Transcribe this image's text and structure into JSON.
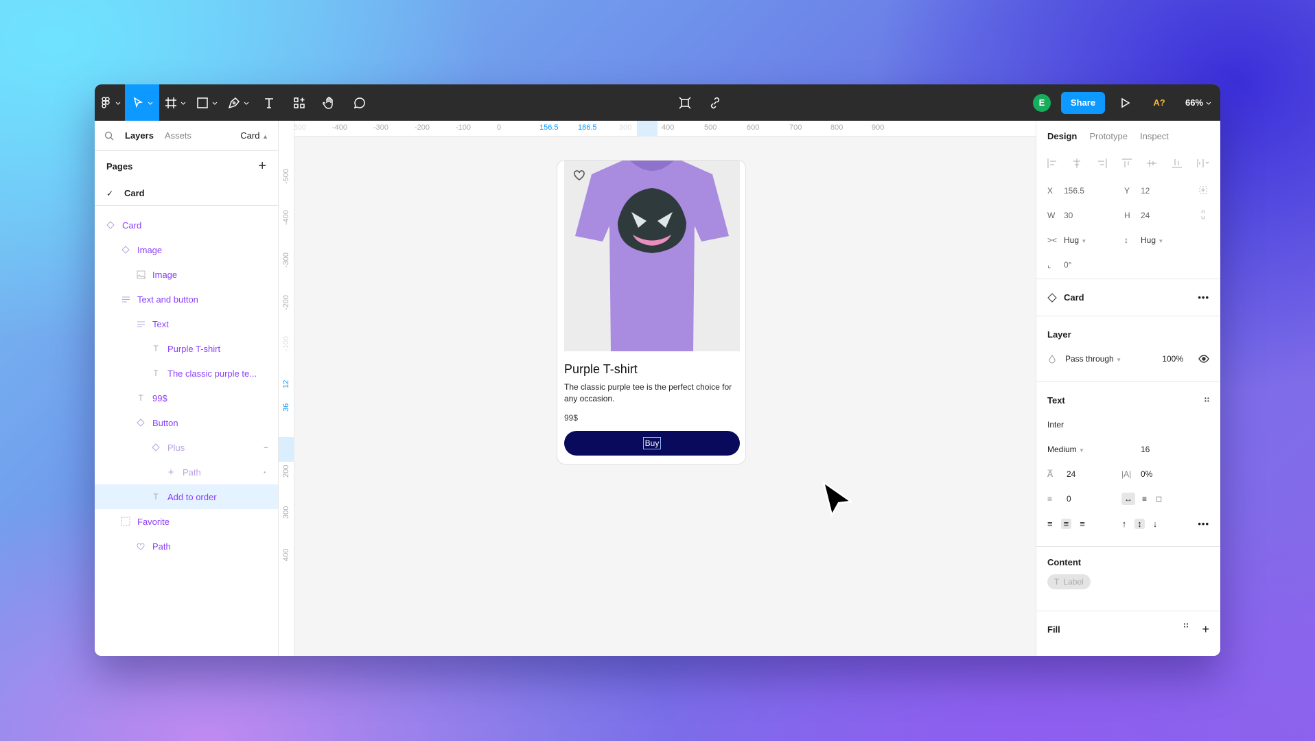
{
  "toolbar": {
    "avatar_initial": "E",
    "share_label": "Share",
    "ai_label": "A?",
    "zoom": "66%"
  },
  "left_panel": {
    "tabs": {
      "layers": "Layers",
      "assets": "Assets",
      "page_select": "Card"
    },
    "pages_title": "Pages",
    "pages": [
      {
        "name": "Card",
        "active": true
      }
    ],
    "layers": [
      {
        "name": "Card",
        "icon": "component-icon",
        "indent": 0
      },
      {
        "name": "Image",
        "icon": "component-icon",
        "indent": 1
      },
      {
        "name": "Image",
        "icon": "image-icon",
        "indent": 2
      },
      {
        "name": "Text and button",
        "icon": "auto-layout-icon",
        "indent": 1
      },
      {
        "name": "Text",
        "icon": "auto-layout-icon",
        "indent": 2
      },
      {
        "name": "Purple T-shirt",
        "icon": "text-icon",
        "indent": 3
      },
      {
        "name": "The classic purple te...",
        "icon": "text-icon",
        "indent": 3
      },
      {
        "name": "99$",
        "icon": "text-icon",
        "indent": 2
      },
      {
        "name": "Button",
        "icon": "component-icon",
        "indent": 2
      },
      {
        "name": "Plus",
        "icon": "component-icon",
        "indent": 3,
        "dim": true
      },
      {
        "name": "Path",
        "icon": "plus-icon",
        "indent": 4,
        "dim": true
      },
      {
        "name": "Add to order",
        "icon": "text-icon",
        "indent": 3,
        "selected": true
      },
      {
        "name": "Favorite",
        "icon": "frame-icon",
        "indent": 1
      },
      {
        "name": "Path",
        "icon": "heart-icon",
        "indent": 2
      }
    ]
  },
  "ruler": {
    "h_ticks": [
      "-500",
      "-400",
      "-300",
      "-200",
      "-100",
      "0",
      "156.5",
      "186.5",
      "300",
      "400",
      "500",
      "600",
      "700",
      "800",
      "900"
    ],
    "v_ticks": [
      "-500",
      "-400",
      "-300",
      "-200",
      "-100",
      "12",
      "36",
      "200",
      "300",
      "400"
    ]
  },
  "card": {
    "title": "Purple T-shirt",
    "description": "The classic purple tee is the perfect choice for any occasion.",
    "price": "99$",
    "button_label": "Buy"
  },
  "right_panel": {
    "tabs": {
      "design": "Design",
      "prototype": "Prototype",
      "inspect": "Inspect"
    },
    "position": {
      "x_label": "X",
      "x": "156.5",
      "y_label": "Y",
      "y": "12",
      "w_label": "W",
      "w": "30",
      "h_label": "H",
      "h": "24",
      "hug_w": "Hug",
      "hug_h": "Hug",
      "rotation": "0°"
    },
    "component": {
      "name": "Card"
    },
    "layer": {
      "title": "Layer",
      "blend": "Pass through",
      "opacity": "100%"
    },
    "text": {
      "title": "Text",
      "font": "Inter",
      "weight": "Medium",
      "size": "16",
      "line_height": "24",
      "letter_spacing": "0%",
      "paragraph_spacing": "0"
    },
    "content": {
      "title": "Content",
      "chip": "Label"
    },
    "fill": {
      "title": "Fill"
    }
  }
}
